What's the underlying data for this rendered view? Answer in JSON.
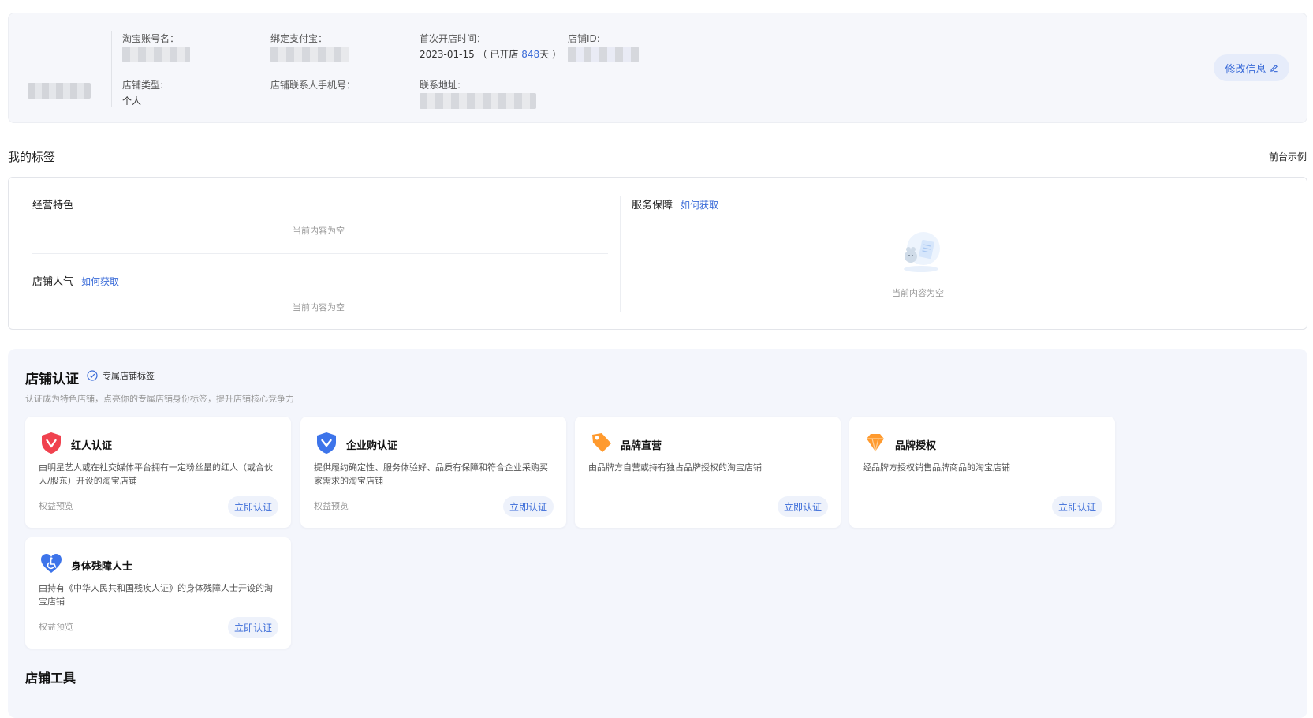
{
  "shop_info": {
    "taobao_account_label": "淘宝账号名：",
    "alipay_label": "绑定支付宝：",
    "first_open_label": "首次开店时间：",
    "first_open_date": "2023-01-15",
    "open_prefix": "（ 已开店",
    "open_days": "848",
    "open_suffix": "天 ）",
    "shop_id_label": "店铺ID:",
    "shop_type_label": "店铺类型:",
    "shop_type_value": "个人",
    "contact_phone_label": "店铺联系人手机号：",
    "address_label": "联系地址:",
    "edit_button": "修改信息"
  },
  "my_tags": {
    "title": "我的标签",
    "front_example": "前台示例",
    "business_feature": "经营特色",
    "shop_popularity": "店铺人气",
    "service_guarantee": "服务保障",
    "how_to_get": "如何获取",
    "empty_text": "当前内容为空"
  },
  "certification": {
    "title": "店铺认证",
    "exclusive_tag": "专属店铺标签",
    "subtitle": "认证成为特色店铺，点亮你的专属店铺身份标签，提升店铺核心竞争力",
    "preview_label": "权益预览",
    "apply_label": "立即认证",
    "cards": [
      {
        "name": "红人认证",
        "icon": "heart-v-shield-icon",
        "color": "#f0424f",
        "desc": "由明星艺人或在社交媒体平台拥有一定粉丝量的红人（或合伙人/股东）开设的淘宝店铺"
      },
      {
        "name": "企业购认证",
        "icon": "blue-shield-v-icon",
        "color": "#3d74ea",
        "desc": "提供履约确定性、服务体验好、品质有保障和符合企业采购买家需求的淘宝店铺"
      },
      {
        "name": "品牌直营",
        "icon": "orange-tag-icon",
        "color": "#ff9a2e",
        "desc": "由品牌方自营或持有独占品牌授权的淘宝店铺"
      },
      {
        "name": "品牌授权",
        "icon": "orange-diamond-icon",
        "color": "#ff9a2e",
        "desc": "经品牌方授权销售品牌商品的淘宝店铺"
      },
      {
        "name": "身体残障人士",
        "icon": "blue-heart-wheelchair-icon",
        "color": "#3d74ea",
        "desc": "由持有《中华人民共和国残疾人证》的身体残障人士开设的淘宝店铺"
      }
    ],
    "tools_title": "店铺工具"
  }
}
